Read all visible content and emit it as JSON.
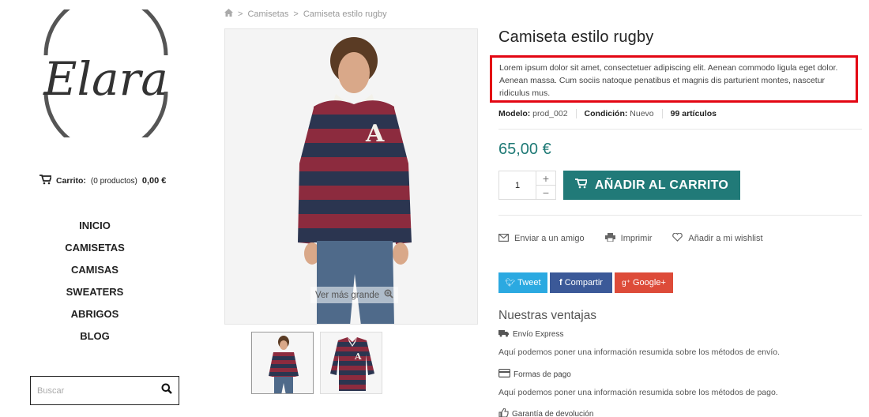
{
  "sidebar": {
    "logo_text": "Elara",
    "cart": {
      "label": "Carrito:",
      "count": "(0 productos)",
      "total": "0,00 €"
    },
    "menu": [
      "INICIO",
      "CAMISETAS",
      "CAMISAS",
      "SWEATERS",
      "ABRIGOS",
      "BLOG"
    ],
    "search_placeholder": "Buscar"
  },
  "breadcrumb": {
    "sep": ">",
    "items": [
      "Camisetas",
      "Camiseta estilo rugby"
    ]
  },
  "gallery": {
    "zoom_label": "Ver más grande"
  },
  "product": {
    "title": "Camiseta estilo rugby",
    "description": "Lorem ipsum dolor sit amet, consectetuer adipiscing elit. Aenean commodo ligula eget dolor. Aenean massa. Cum sociis natoque penatibus et magnis dis parturient montes, nascetur ridiculus mus.",
    "model_label": "Modelo:",
    "model_value": "prod_002",
    "condition_label": "Condición:",
    "condition_value": "Nuevo",
    "stock": "99 artículos",
    "price": "65,00 €",
    "quantity": "1",
    "add_to_cart": "AÑADIR AL CARRITO"
  },
  "actions": {
    "send": "Enviar a un amigo",
    "print": "Imprimir",
    "wishlist": "Añadir a mi wishlist"
  },
  "social": {
    "tweet": "Tweet",
    "share": "Compartir",
    "google": "Google+"
  },
  "advantages": {
    "title": "Nuestras ventajas",
    "items": [
      {
        "label": "Envío Express",
        "text": "Aquí podemos poner una información resumida sobre los métodos de envío."
      },
      {
        "label": "Formas de pago",
        "text": "Aquí podemos poner una información resumida sobre los métodos de pago."
      },
      {
        "label": "Garantía de devolución"
      }
    ]
  },
  "colors": {
    "accent": "#217a78",
    "highlight": "#e30613",
    "twitter": "#2ba9e1",
    "facebook": "#3b5998",
    "google": "#dd4b39"
  }
}
